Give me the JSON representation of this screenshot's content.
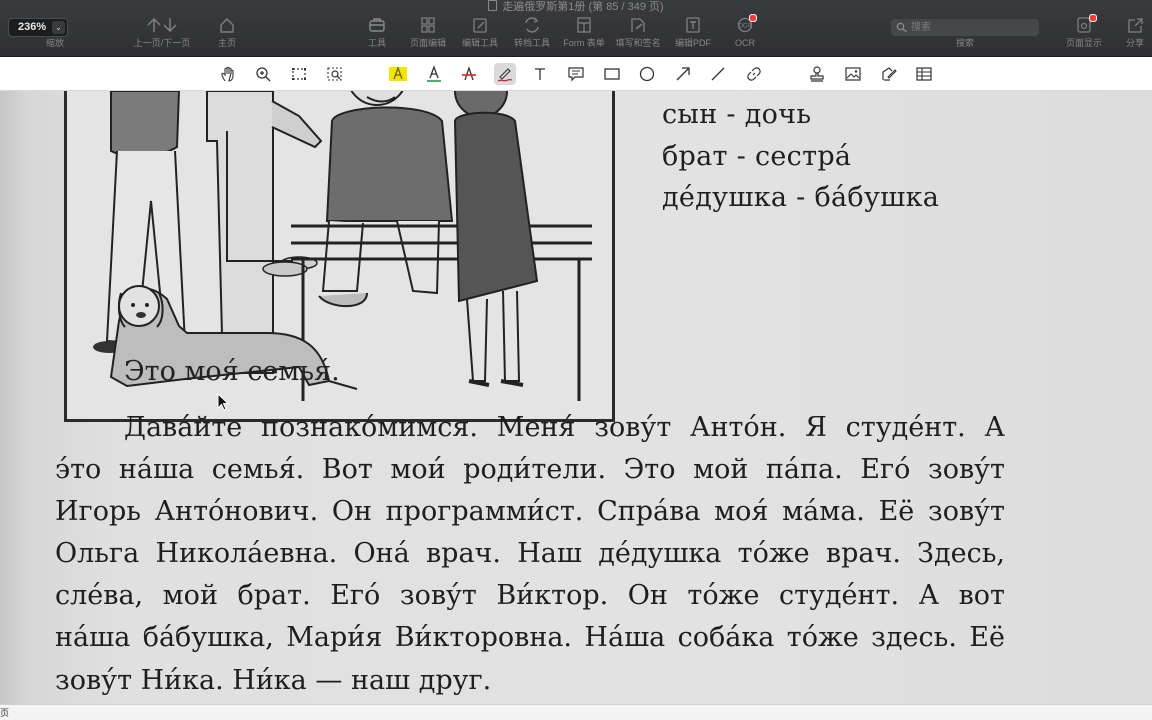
{
  "window": {
    "title": "走遍俄罗斯第1册 (第 85 / 349 页)"
  },
  "zoom": {
    "value": "236%"
  },
  "toolbar": {
    "zoom_label": "缩放",
    "nav_label": "上一页/下一页",
    "home_label": "主页",
    "tools_label": "工具",
    "page_edit_label": "页面编辑",
    "edit_tool_label": "编辑工具",
    "convert_label": "转档工具",
    "form_label": "Form 表单",
    "fill_sign_label": "填写和签名",
    "edit_pdf_label": "编辑PDF",
    "ocr_label": "OCR",
    "search_label": "搜索",
    "page_display_label": "页面显示",
    "share_label": "分享"
  },
  "search": {
    "placeholder": "搜索"
  },
  "annotation_tools": [
    "hand-tool",
    "zoom-tool",
    "marquee-select",
    "area-text-select",
    "highlight-text",
    "underline-text",
    "strikethrough-text",
    "freehand-pen",
    "text-box",
    "note",
    "rectangle",
    "ellipse",
    "arrow",
    "line",
    "link",
    "stamp",
    "image",
    "signature",
    "table"
  ],
  "document": {
    "vocab": [
      "сын - дочь",
      "брат - сестра́",
      "де́душка - ба́бушка"
    ],
    "caption": "Это моя́ семья́.",
    "paragraph_lines": [
      "Дава́йте познако́мимся. Меня́ зову́т Анто́н. Я студе́нт. А",
      "э́то на́ша семья́. Вот мои́ роди́тели. Это мой па́па. Его́ зову́т",
      "Игорь Анто́нович. Он программи́ст. Спра́ва моя́ ма́ма. Её зову́т",
      "Ольга Никола́евна. Она́ врач. Наш де́душка то́же врач. Здесь,",
      "сле́ва, мой брат. Его́ зову́т Ви́ктор. Он то́же студе́нт. А вот",
      "на́ша ба́бушка, Мари́я Ви́кторовна. На́ша соба́ка то́же здесь. Её",
      "зову́т Ни́ка. Ни́ка — наш друг."
    ]
  },
  "status": {
    "text": "页"
  },
  "colors": {
    "accent_red": "#ff3b30",
    "highlight_yellow": "#f5e500",
    "underline_green": "#1f9e3a",
    "strike_red": "#e02020",
    "pen_red": "#d6224a"
  }
}
